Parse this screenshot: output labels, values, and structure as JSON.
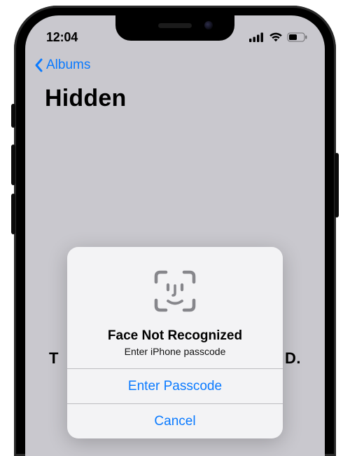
{
  "status": {
    "time": "12:04"
  },
  "nav": {
    "back": "Albums",
    "title": "Hidden"
  },
  "bg_line": {
    "left": "T",
    "right": "D."
  },
  "modal": {
    "title": "Face Not Recognized",
    "subtitle": "Enter iPhone passcode",
    "primary": "Enter Passcode",
    "secondary": "Cancel"
  },
  "colors": {
    "accent": "#0a7aff"
  }
}
